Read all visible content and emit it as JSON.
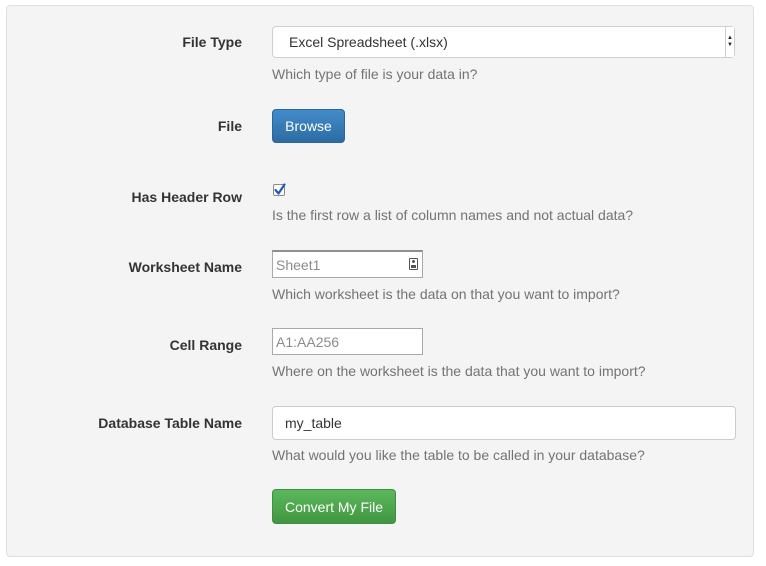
{
  "form": {
    "file_type": {
      "label": "File Type",
      "selected": "Excel Spreadsheet (.xlsx)",
      "help": "Which type of file is your data in?"
    },
    "file": {
      "label": "File",
      "button": "Browse"
    },
    "header_row": {
      "label": "Has Header Row",
      "checked": true,
      "help": "Is the first row a list of column names and not actual data?"
    },
    "worksheet": {
      "label": "Worksheet Name",
      "placeholder": "Sheet1",
      "help": "Which worksheet is the data on that you want to import?"
    },
    "cell_range": {
      "label": "Cell Range",
      "placeholder": "A1:AA256",
      "help": "Where on the worksheet is the data that you want to import?"
    },
    "table_name": {
      "label": "Database Table Name",
      "value": "my_table",
      "help": "What would you like the table to be called in your database?"
    },
    "submit": "Convert My File"
  },
  "colors": {
    "primary": "#428bca",
    "success": "#5cb85c",
    "help_text": "#737373",
    "panel_bg": "#f4f4f4"
  },
  "icons": {
    "checkbox_checked": "checkmark-icon",
    "select_arrows": "updown-arrows-icon",
    "contact_card": "contact-card-icon"
  }
}
